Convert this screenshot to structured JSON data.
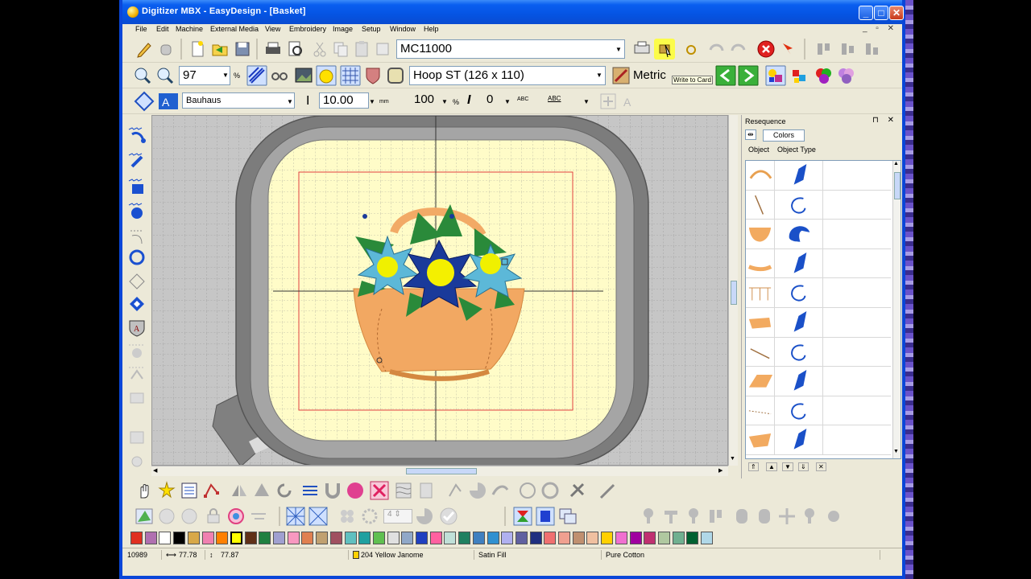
{
  "window": {
    "title": "Digitizer MBX - EasyDesign - [Basket]",
    "minimize_label": "_",
    "maximize_label": "□",
    "close_label": "✕"
  },
  "menu": [
    "File",
    "Edit",
    "Machine",
    "External Media",
    "View",
    "Embroidery",
    "Image",
    "Setup",
    "Window",
    "Help"
  ],
  "mdi_controls": "_ ▫ ✕",
  "toolbar1": {
    "machine": "MC11000"
  },
  "toolbar2": {
    "zoom": "97",
    "zoom_unit": "%",
    "hoop": "Hoop ST (126 x 110)",
    "units": "Metric",
    "write_to_card_tooltip": "Write to Card"
  },
  "toolbar3": {
    "font": "Bauhaus",
    "height": "10.00",
    "height_unit": "mm",
    "width": "100",
    "width_unit": "%",
    "slant": "0",
    "abc1": "ABC",
    "abc2": "ABC"
  },
  "panel": {
    "title": "Resequence",
    "pin_close": "⊓ ✕",
    "tab_colors": "Colors",
    "col_object": "Object",
    "col_object_type": "Object Type",
    "rows": [
      {
        "object_icon": "arc-outline-icon",
        "type_icon": "blue-fill-icon"
      },
      {
        "object_icon": "line-icon",
        "type_icon": "run-stitch-icon"
      },
      {
        "object_icon": "bowl-fill-icon",
        "type_icon": "satin-icon"
      },
      {
        "object_icon": "arc-strip-icon",
        "type_icon": "blue-fill-icon"
      },
      {
        "object_icon": "comb-outline-icon",
        "type_icon": "run-stitch-icon"
      },
      {
        "object_icon": "blob-fill-icon",
        "type_icon": "blue-fill-icon"
      },
      {
        "object_icon": "line-icon",
        "type_icon": "run-stitch-icon"
      },
      {
        "object_icon": "parallelogram-fill-icon",
        "type_icon": "blue-fill-icon"
      },
      {
        "object_icon": "dotted-line-icon",
        "type_icon": "run-stitch-icon"
      },
      {
        "object_icon": "wedge-fill-icon",
        "type_icon": "blue-fill-icon"
      }
    ]
  },
  "palette": [
    "#e03020",
    "#b070b0",
    "#ffffff",
    "#000000",
    "#d8a848",
    "#f080b0",
    "#ff8000",
    "#ffff00",
    "#603018",
    "#208040",
    "#a0a0d0",
    "#f898c0",
    "#e08050",
    "#c0a070",
    "#a05060",
    "#60c0c0",
    "#20a0a0",
    "#60c050",
    "#e0e0e0",
    "#90a8c8",
    "#2040c0",
    "#ff60a0",
    "#c0e0d8",
    "#208060",
    "#4080c0",
    "#3090d0",
    "#b0b0f0",
    "#6060a0",
    "#203080",
    "#f07070",
    "#f0a090",
    "#c09070",
    "#f0c0a0",
    "#ffd000",
    "#f070d0",
    "#a000a0",
    "#c03070",
    "#b0c8a0",
    "#70b090",
    "#006030",
    "#b0d8e8"
  ],
  "status": {
    "stitches": "10989",
    "width": "77.78",
    "height": "77.87",
    "thread": "204 Yellow Janome",
    "stitch_type": "Satin Fill",
    "fabric": "Pure Cotton"
  }
}
